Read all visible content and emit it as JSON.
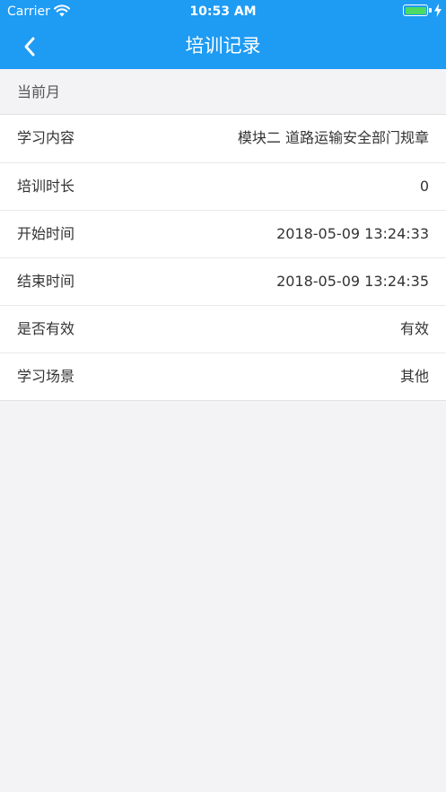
{
  "status_bar": {
    "carrier": "Carrier",
    "time": "10:53 AM",
    "wifi_icon": "wifi-icon",
    "battery_icon": "battery-icon",
    "charging_icon": "lightning-bolt-icon"
  },
  "nav": {
    "title": "培训记录",
    "back_icon": "chevron-left-icon"
  },
  "section": {
    "title": "当前月"
  },
  "rows": [
    {
      "label": "学习内容",
      "value": "模块二 道路运输安全部门规章"
    },
    {
      "label": "培训时长",
      "value": "0"
    },
    {
      "label": "开始时间",
      "value": "2018-05-09 13:24:33"
    },
    {
      "label": "结束时间",
      "value": "2018-05-09 13:24:35"
    },
    {
      "label": "是否有效",
      "value": "有效"
    },
    {
      "label": "学习场景",
      "value": "其他"
    }
  ],
  "colors": {
    "nav_background": "#1e9bf3",
    "page_background": "#f3f3f5",
    "battery_fill": "#4cd964"
  }
}
